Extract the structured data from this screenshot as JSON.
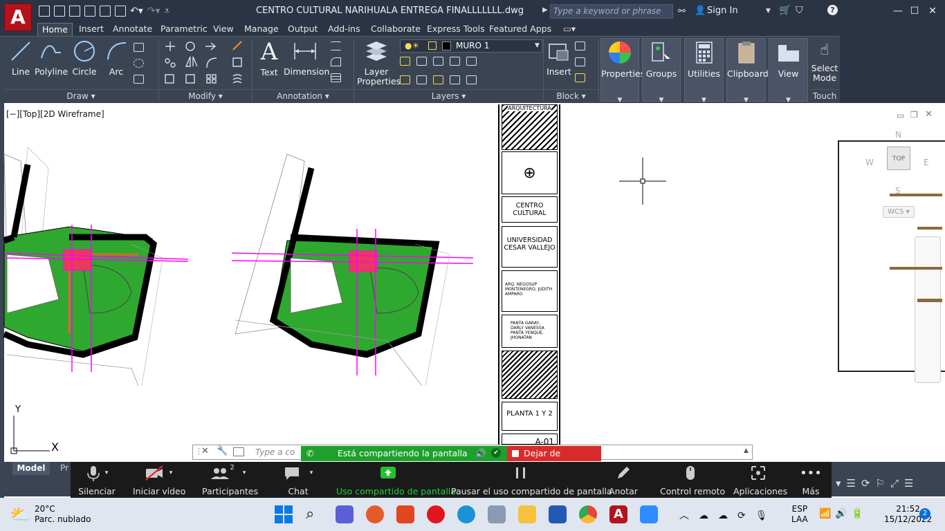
{
  "app": {
    "logo_letter": "A",
    "doc_title": "CENTRO CULTURAL NARIHUALA ENTREGA FINALLLLLLL.dwg"
  },
  "header": {
    "search_placeholder": "Type a keyword or phrase",
    "sign_in": "Sign In"
  },
  "menu_tabs": [
    "Home",
    "Insert",
    "Annotate",
    "Parametric",
    "View",
    "Manage",
    "Output",
    "Add-ins",
    "Collaborate",
    "Express Tools",
    "Featured Apps"
  ],
  "ribbon": {
    "draw": {
      "title": "Draw",
      "tools": [
        "Line",
        "Polyline",
        "Circle",
        "Arc"
      ]
    },
    "modify": {
      "title": "Modify"
    },
    "annotation": {
      "title": "Annotation",
      "tools": [
        "Text",
        "Dimension"
      ]
    },
    "layers": {
      "title": "Layers",
      "layer_props": "Layer Properties",
      "current_layer": "MURO 1"
    },
    "block": {
      "title": "Block",
      "insert": "Insert"
    },
    "properties": "Properties",
    "groups": "Groups",
    "utilities": "Utilities",
    "clipboard": "Clipboard",
    "view": "View",
    "select_mode": "Select Mode",
    "touch": "Touch"
  },
  "viewport": {
    "label": "[−][Top][2D Wireframe]"
  },
  "viewcube": {
    "top": "TOP",
    "n": "N",
    "s": "S",
    "e": "E",
    "w": "W",
    "wcs": "WCS"
  },
  "title_block": {
    "school": "ARQUITECTURA",
    "center": "CENTRO CULTURAL",
    "university": "UNIVERSIDAD CESAR VALLEJO",
    "advisor": "ARQ. NEGOSUP MONTENEGRO, JUDITH AMPARO",
    "students": [
      "PANTA GARAY, DARLY VANESSA",
      "PANTA YENQUE, JHONATAN"
    ],
    "sheet": "PLANTA 1 Y 2",
    "sheet_code": "A-01"
  },
  "ucs": {
    "y": "Y",
    "x": "X"
  },
  "cmdline": {
    "placeholder": "Type a co"
  },
  "share": {
    "banner": "Está compartiendo la pantalla",
    "stop": "Dejar de compartir"
  },
  "layout_tabs": {
    "model": "Model",
    "partial": "Pr"
  },
  "meeting": {
    "mute": "Silenciar",
    "video": "Iniciar vídeo",
    "participants": "Participantes",
    "participants_count": "2",
    "chat": "Chat",
    "share": "Uso compartido de pantalla",
    "pause": "Pausar el uso compartido de pantalla",
    "annotate": "Anotar",
    "remote": "Control remoto",
    "apps": "Aplicaciones",
    "more": "Más"
  },
  "weather": {
    "temp": "20°C",
    "desc": "Parc. nublado"
  },
  "tray": {
    "lang1": "ESP",
    "lang2": "LAA",
    "time": "21:52",
    "date": "15/12/2022",
    "notif": "2"
  },
  "colors": {
    "title_bar": "#2b3445",
    "ribbon": "#3b4453",
    "share_green": "#1fa02c",
    "stop_red": "#d92b2b",
    "magenta": "#ff00ff",
    "park_green": "#2fa82f"
  }
}
